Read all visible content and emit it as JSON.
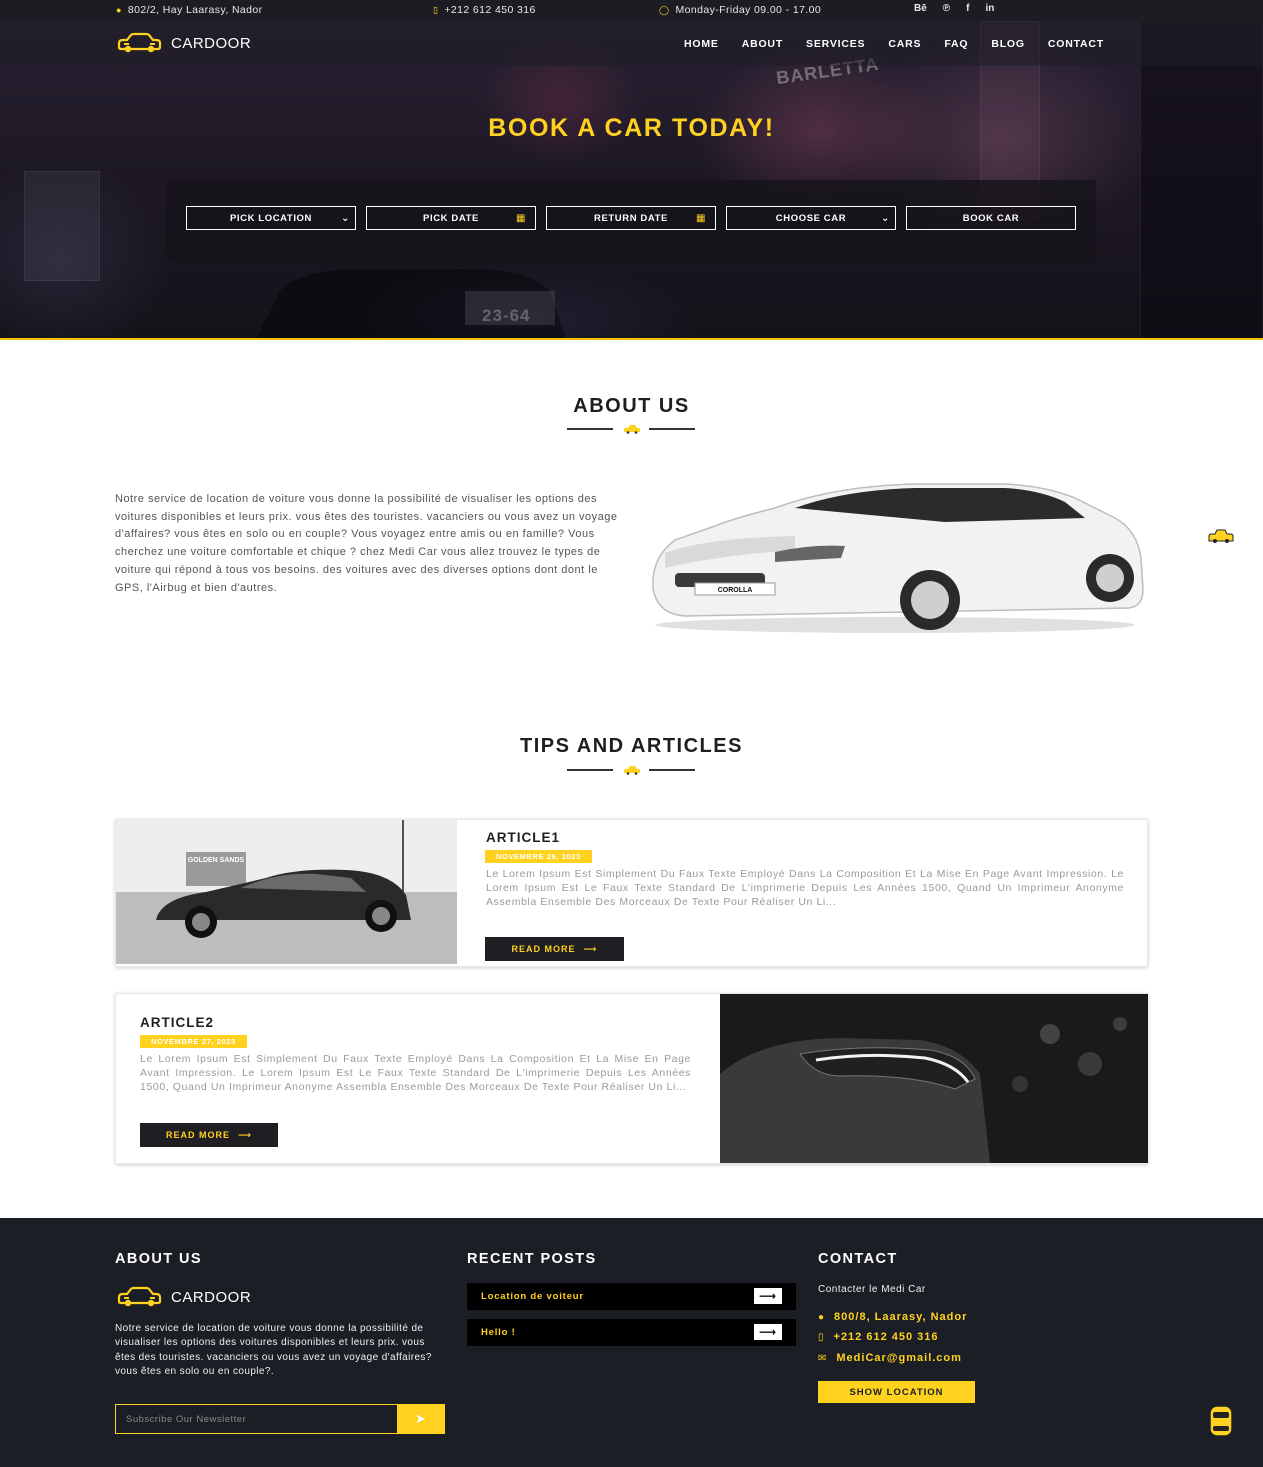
{
  "topbar": {
    "address": "802/2, Hay Laarasy, Nador",
    "phone": "+212 612 450 316",
    "hours": "Monday-Friday 09.00 - 17.00",
    "social": [
      "Bē",
      "℗",
      "f",
      "in"
    ],
    "icons": [
      "map-pin-icon",
      "phone-icon",
      "clock-icon"
    ]
  },
  "brand": {
    "name": "CARDOOR",
    "accent": "#ffd21f",
    "dark": "#1c1e26"
  },
  "nav": {
    "items": [
      "HOME",
      "ABOUT",
      "SERVICES",
      "CARS",
      "FAQ",
      "BLOG",
      "CONTACT"
    ]
  },
  "hero": {
    "title": "BOOK A CAR TODAY!",
    "pick_location": "PICK LOCATION",
    "pick_date": "PICK DATE",
    "return_date": "RETURN DATE",
    "choose_car": "CHOOSE CAR",
    "book_car": "BOOK CAR",
    "signs": [
      "BARLETTA",
      "23-64"
    ]
  },
  "about": {
    "title": "ABOUT US",
    "text": "Notre service de location de voiture vous donne la possibilité de visualiser les options des voitures disponibles et leurs prix. vous êtes des touristes. vacanciers ou vous avez un voyage d'affaires? vous êtes en solo ou en couple? Vous voyagez entre amis ou en famille? Vous cherchez une voiture comfortable et chique ? chez Medi Car vous allez trouvez le types de voiture qui répond à tous vos besoins. des voitures avec des diverses options dont dont le GPS, l'Airbug et bien d'autres.",
    "car_plate": "COROLLA"
  },
  "articles": {
    "title": "TIPS AND ARTICLES",
    "items": [
      {
        "title": "ARTICLE1",
        "date": "NOVEMBRE 26, 2023",
        "body": "Le Lorem Ipsum Est Simplement Du Faux Texte Employé Dans La Composition Et La Mise En Page Avant Impression. Le Lorem Ipsum Est Le Faux Texte Standard De L'imprimerie Depuis Les Années 1500, Quand Un Imprimeur Anonyme Assembla Ensemble Des Morceaux De Texte Pour Réaliser Un Li...",
        "cta": "READ MORE"
      },
      {
        "title": "ARTICLE2",
        "date": "NOVEMBRE 27, 2023",
        "body": "Le Lorem Ipsum Est Simplement Du Faux Texte Employé Dans La Composition Et La Mise En Page Avant Impression. Le Lorem Ipsum Est Le Faux Texte Standard De L'imprimerie Depuis Les Années 1500, Quand Un Imprimeur Anonyme Assembla Ensemble Des Morceaux De Texte Pour Réaliser Un Li...",
        "cta": "READ MORE"
      }
    ],
    "photo_sign": "GOLDEN SANDS"
  },
  "footer": {
    "about_title": "ABOUT US",
    "about_text": "Notre service de location de voiture vous donne la possibilité de visualiser les options des voitures disponibles et leurs prix. vous êtes des touristes. vacanciers ou vous avez un voyage d'affaires? vous êtes en solo ou en couple?.",
    "newsletter_placeholder": "Subscribe Our Newsletter",
    "posts_title": "RECENT POSTS",
    "posts": [
      "Location de voiteur",
      "Hello !"
    ],
    "contact_title": "CONTACT",
    "contact_intro": "Contacter le Medi Car",
    "contact_address": "800/8, Laarasy, Nador",
    "contact_phone": "+212 612 450 316",
    "contact_email": "MediCar@gmail.com",
    "show_location": "SHOW LOCATION"
  }
}
